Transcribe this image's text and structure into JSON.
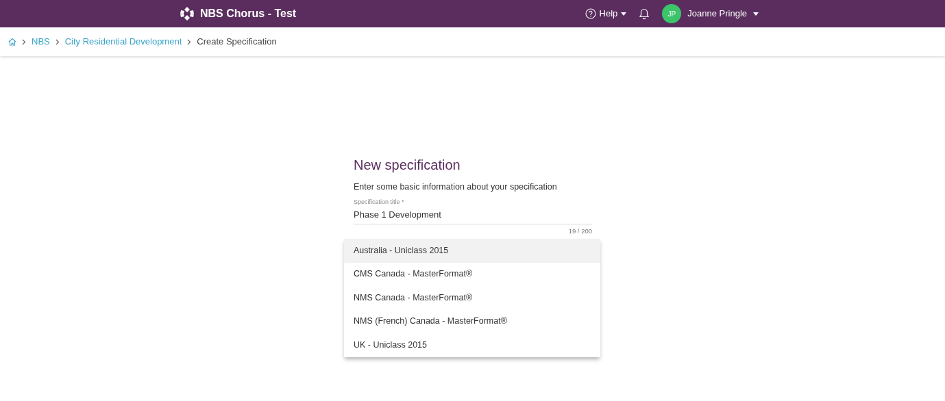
{
  "header": {
    "app_title": "NBS Chorus - Test",
    "help": "Help",
    "user": {
      "initials": "JP",
      "name": "Joanne Pringle"
    }
  },
  "breadcrumb": [
    {
      "label": "NBS",
      "link": true
    },
    {
      "label": "City Residential Development",
      "link": true
    },
    {
      "label": "Create Specification",
      "link": false
    }
  ],
  "form": {
    "heading": "New specification",
    "intro": "Enter some basic information about your specification",
    "title_field": {
      "label": "Specification title *",
      "value": "Phase 1 Development",
      "counter": "19 / 200"
    }
  },
  "dropdown": {
    "options": [
      {
        "label": "Australia - Uniclass 2015",
        "selected": true
      },
      {
        "label": "CMS Canada - MasterFormat®",
        "selected": false
      },
      {
        "label": "NMS Canada - MasterFormat®",
        "selected": false
      },
      {
        "label": "NMS (French) Canada - MasterFormat®",
        "selected": false
      },
      {
        "label": "UK - Uniclass 2015",
        "selected": false
      }
    ]
  }
}
